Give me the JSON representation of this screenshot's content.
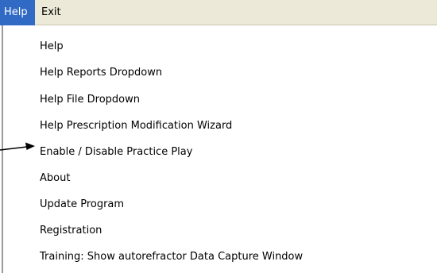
{
  "menubar": {
    "items": [
      {
        "label": "Help",
        "state": "open"
      },
      {
        "label": "Exit"
      }
    ]
  },
  "help_menu": {
    "items": [
      {
        "label": "Help"
      },
      {
        "label": "Help Reports Dropdown"
      },
      {
        "label": "Help File Dropdown"
      },
      {
        "label": "Help Prescription Modification Wizard"
      },
      {
        "label": "Enable / Disable Practice Play"
      },
      {
        "label": "About"
      },
      {
        "label": "Update Program"
      },
      {
        "label": "Registration"
      },
      {
        "label": "Training: Show autorefractor Data Capture Window"
      }
    ]
  },
  "annotation": {
    "pointer": "arrow-icon",
    "target": "Enable / Disable Practice Play"
  },
  "colors": {
    "menubar_bg": "#ece9d8",
    "highlight": "#316ac5",
    "highlight_text": "#ffffff"
  }
}
